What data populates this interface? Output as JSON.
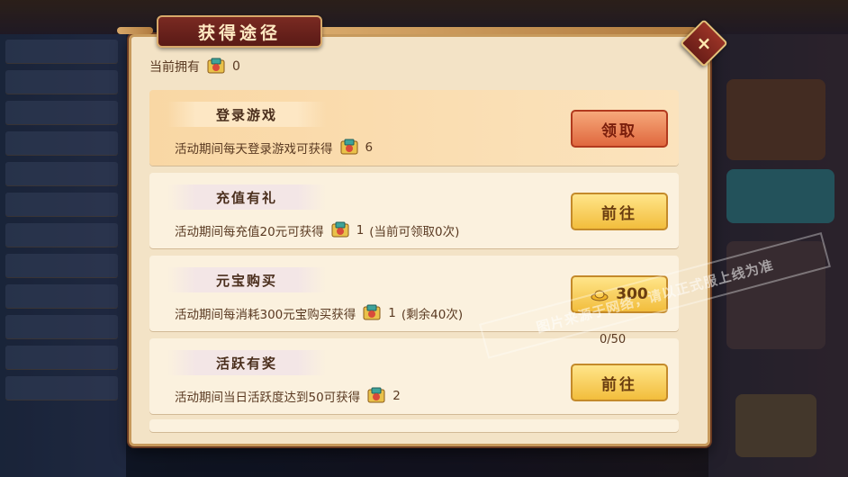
{
  "dialog": {
    "title": "获得途径",
    "close_icon": "×",
    "owned_label": "当前拥有",
    "owned_count": "0"
  },
  "tasks": [
    {
      "name": "登录游戏",
      "desc_prefix": "活动期间每天登录游戏可获得",
      "reward": "6",
      "suffix": "",
      "button": "领取",
      "button_style": "red"
    },
    {
      "name": "充值有礼",
      "desc_prefix": "活动期间每充值20元可获得",
      "reward": "1",
      "suffix": "(当前可领取0次)",
      "button": "前往",
      "button_style": "gold"
    },
    {
      "name": "元宝购买",
      "desc_prefix": "活动期间每消耗300元宝购买获得",
      "reward": "1",
      "suffix": "(剩余40次)",
      "button": "300",
      "button_icon": "gold-ingot-icon",
      "button_style": "gold"
    },
    {
      "name": "活跃有奖",
      "desc_prefix": "活动期间当日活跃度达到50可获得",
      "reward": "2",
      "suffix": "",
      "progress": "0/50",
      "button": "前往",
      "button_style": "gold"
    }
  ],
  "watermark": "图片来源于网络，请以正式服上线为准",
  "colors": {
    "panel": "#f3e3c6",
    "title_plaque": "#7a2a22",
    "red_button": "#e0683e",
    "gold_button": "#f2bd3c"
  }
}
